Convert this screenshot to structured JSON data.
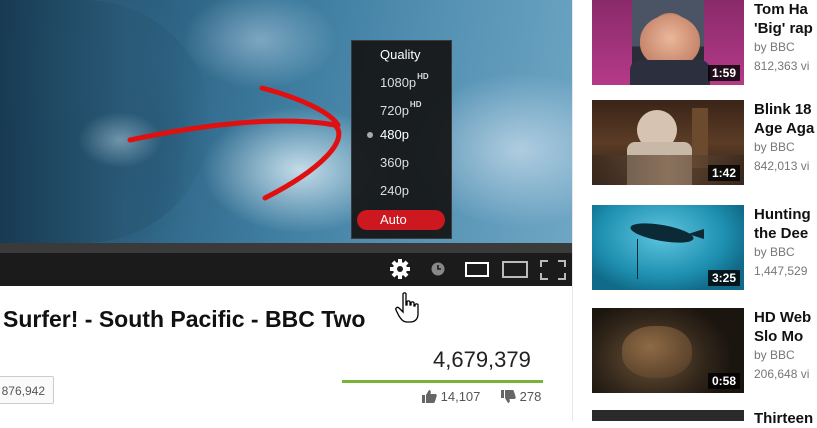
{
  "video": {
    "title": "Surfer! - South Pacific - BBC Two",
    "view_count": "4,679,379",
    "likes": "14,107",
    "dislikes": "278",
    "subscriber_count": "876,942"
  },
  "quality_menu": {
    "title": "Quality",
    "options": [
      {
        "label": "1080p",
        "badge": "HD"
      },
      {
        "label": "720p",
        "badge": "HD"
      },
      {
        "label": "480p",
        "badge": ""
      },
      {
        "label": "360p",
        "badge": ""
      },
      {
        "label": "240p",
        "badge": ""
      }
    ],
    "auto_label": "Auto",
    "selected": "480p",
    "accent_color": "#cc181e"
  },
  "controls": {
    "icons": [
      "settings-gear-icon",
      "watch-later-icon",
      "small-player-icon",
      "large-player-icon",
      "fullscreen-icon"
    ]
  },
  "related": [
    {
      "title": "Tom Ha\n'Big' rap",
      "by": "by BBC",
      "views": "812,363 vi",
      "duration": "1:59"
    },
    {
      "title": "Blink 18\nAge Aga",
      "by": "by BBC",
      "views": "842,013 vi",
      "duration": "1:42"
    },
    {
      "title": "Hunting\nthe Dee",
      "by": "by BBC",
      "views": "1,447,529",
      "duration": "3:25"
    },
    {
      "title": "HD Web\nSlo Mo",
      "by": "by BBC",
      "views": "206,648 vi",
      "duration": "0:58"
    },
    {
      "title": "Thirteen",
      "by": "",
      "views": "",
      "duration": ""
    }
  ]
}
